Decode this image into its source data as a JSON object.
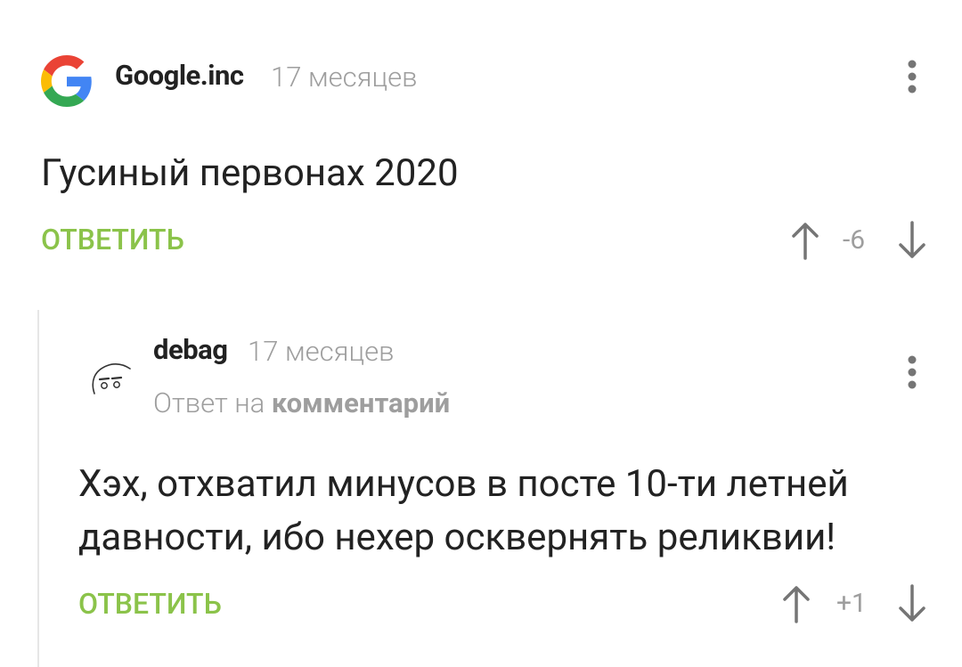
{
  "comments": [
    {
      "author": "Google.inc",
      "time": "17 месяцев",
      "text": "Гусиный первонах 2020",
      "reply_label": "ОТВЕТИТЬ",
      "score": "-6",
      "avatar_icon": "google-logo-icon"
    },
    {
      "author": "debag",
      "time": "17 месяцев",
      "reply_to_prefix": "Ответ на",
      "reply_to_link": "комментарий",
      "text": "Хэх, отхватил минусов в посте 10-ти летней давности, ибо нехер осквернять реликвии!",
      "reply_label": "ОТВЕТИТЬ",
      "score": "+1",
      "avatar_icon": "face-sketch-icon"
    }
  ],
  "colors": {
    "accent": "#8bc34a",
    "muted": "#9e9e9e",
    "text": "#222222",
    "thread_line": "#e6e6e6"
  },
  "icons": {
    "menu": "more-vertical-icon",
    "upvote": "arrow-up-icon",
    "downvote": "arrow-down-icon"
  }
}
